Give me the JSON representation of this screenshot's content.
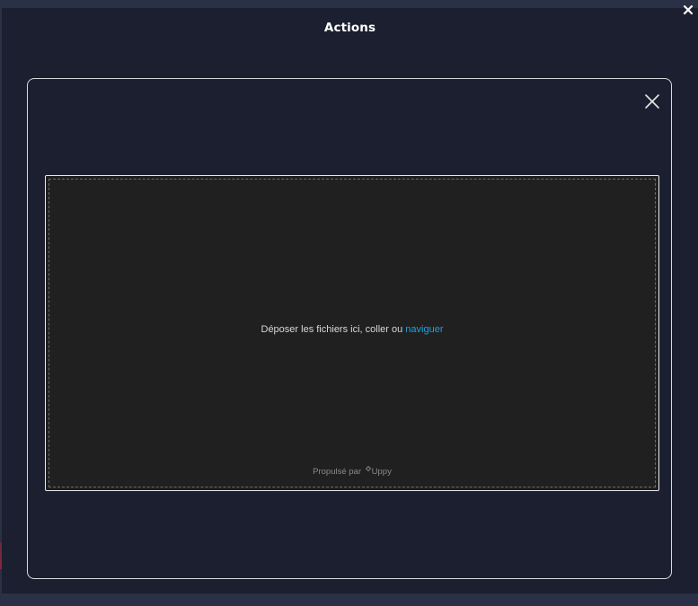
{
  "window": {
    "title": "Actions",
    "close_icon": "close-icon"
  },
  "modal": {
    "close_icon": "close-icon"
  },
  "uploader": {
    "drop_text": "Déposer les fichiers ici, coller ou ",
    "browse_label": "naviguer",
    "powered_by_label": "Propulsé par",
    "brand_name": "Uppy",
    "brand_icon": "uppy-icon",
    "colors": {
      "link": "#1aa3e0",
      "dropzone_bg": "#202020"
    }
  }
}
